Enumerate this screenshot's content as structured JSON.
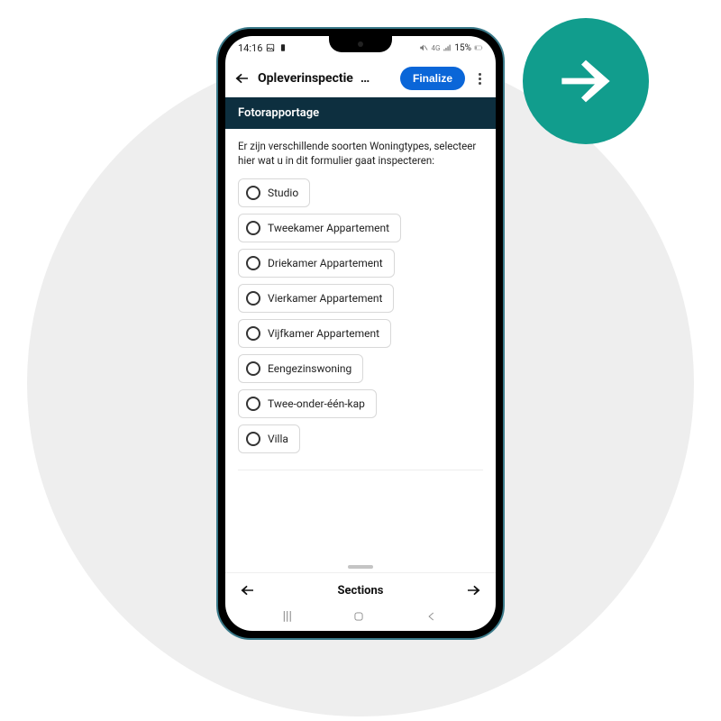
{
  "statusbar": {
    "time": "14:16",
    "battery_text": "15%"
  },
  "header": {
    "title": "Opleverinspectie",
    "title_trunc": "…",
    "finalize_label": "Finalize"
  },
  "section_band": "Fotorapportage",
  "intro_text": "Er zijn verschillende soorten Woningtypes, selecteer hier wat u in dit formulier gaat inspecteren:",
  "options": [
    "Studio",
    "Tweekamer Appartement",
    "Driekamer Appartement",
    "Vierkamer Appartement",
    "Vijfkamer Appartement",
    "Eengezinswoning",
    "Twee-onder-één-kap",
    "Villa"
  ],
  "bottom_nav": {
    "title": "Sections"
  }
}
